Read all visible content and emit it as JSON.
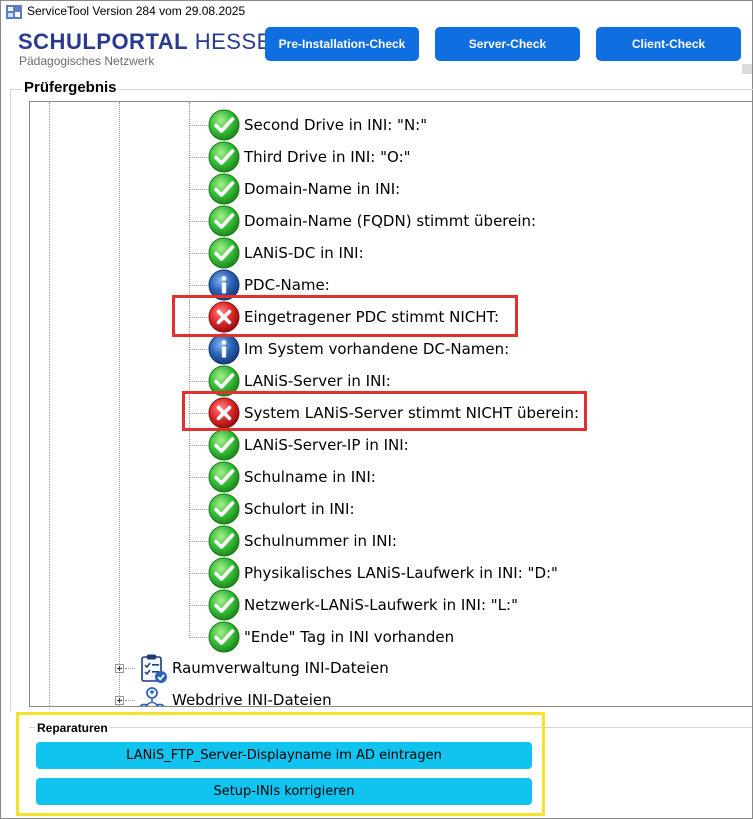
{
  "window": {
    "title": "ServiceTool Version 284 vom 29.08.2025"
  },
  "logo": {
    "brand_bold": "SCHULPORTAL",
    "brand_light": "HESSEN",
    "subtitle": "Pädagogisches Netzwerk"
  },
  "header_buttons": {
    "pre_installation": "Pre-Installation-Check",
    "server": "Server-Check",
    "client": "Client-Check"
  },
  "result_group": {
    "title": "Prüfergebnis",
    "items": [
      {
        "label": "Second Drive in INI: \"N:\"",
        "status": "ok"
      },
      {
        "label": "Third Drive in INI: \"O:\"",
        "status": "ok"
      },
      {
        "label": "Domain-Name in INI:",
        "status": "ok"
      },
      {
        "label": "Domain-Name (FQDN) stimmt überein:",
        "status": "ok"
      },
      {
        "label": "LANiS-DC in INI:",
        "status": "ok"
      },
      {
        "label": "PDC-Name:",
        "status": "info"
      },
      {
        "label": "Eingetragener PDC stimmt NICHT:",
        "status": "error"
      },
      {
        "label": "Im System vorhandene DC-Namen:",
        "status": "info"
      },
      {
        "label": "LANiS-Server in INI:",
        "status": "ok"
      },
      {
        "label": "System LANiS-Server stimmt NICHT überein:",
        "status": "error"
      },
      {
        "label": "LANiS-Server-IP in INI:",
        "status": "ok"
      },
      {
        "label": "Schulname in INI:",
        "status": "ok"
      },
      {
        "label": "Schulort in INI:",
        "status": "ok"
      },
      {
        "label": "Schulnummer in INI:",
        "status": "ok"
      },
      {
        "label": "Physikalisches LANiS-Laufwerk in INI: \"D:\"",
        "status": "ok"
      },
      {
        "label": "Netzwerk-LANiS-Laufwerk in INI: \"L:\"",
        "status": "ok"
      },
      {
        "label": "\"Ende\" Tag in INI vorhanden",
        "status": "ok"
      }
    ],
    "sub_nodes": [
      {
        "label": "Raumverwaltung INI-Dateien",
        "icon": "clipboard-check-icon"
      },
      {
        "label": "Webdrive INI-Dateien",
        "icon": "network-users-icon"
      }
    ]
  },
  "repairs_group": {
    "title": "Reparaturen",
    "buttons": [
      "LANiS_FTP_Server-Displayname im AD eintragen",
      "Setup-INIs korrigieren"
    ]
  },
  "colors": {
    "brand_blue": "#2a3a8c",
    "header_button": "#0f6fe0",
    "repair_button": "#11c4ef",
    "ok_green": "#2fb52f",
    "error_red": "#d42222",
    "info_blue": "#2b63b8",
    "highlight_red": "#e03030",
    "highlight_yellow": "#f5e52a"
  }
}
